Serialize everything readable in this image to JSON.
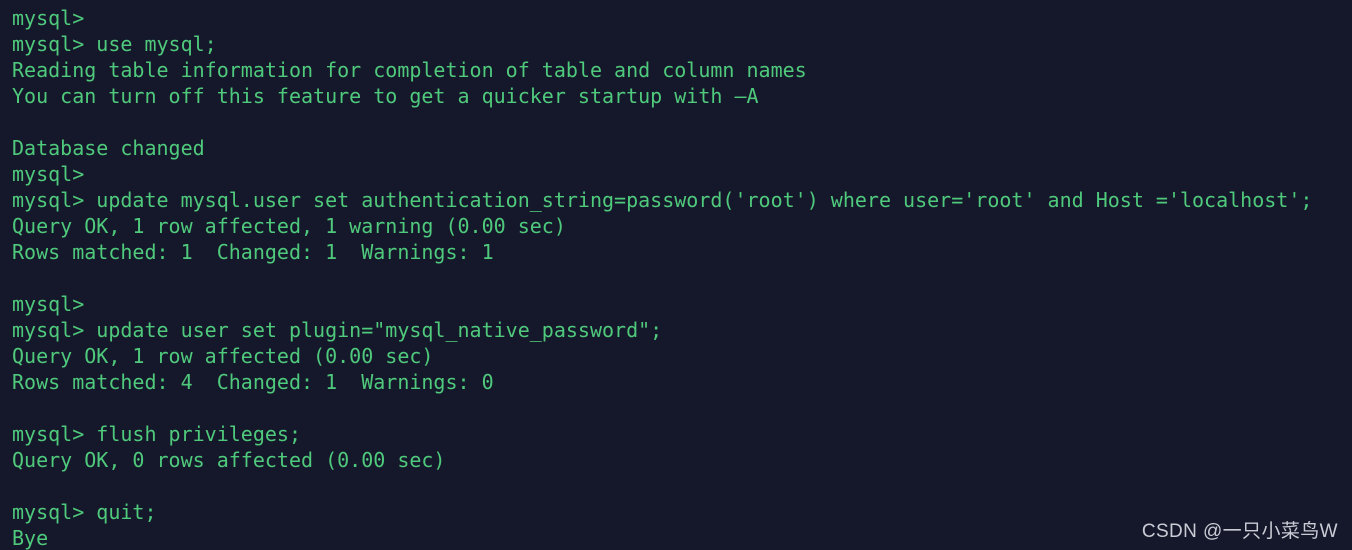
{
  "terminal": {
    "background_color": "#15182a",
    "text_color": "#4fc97c",
    "prompt": "mysql>",
    "lines": [
      "mysql>",
      "mysql> use mysql;",
      "Reading table information for completion of table and column names",
      "You can turn off this feature to get a quicker startup with –A",
      "",
      "Database changed",
      "mysql>",
      "mysql> update mysql.user set authentication_string=password('root') where user='root' and Host ='localhost';",
      "Query OK, 1 row affected, 1 warning (0.00 sec)",
      "Rows matched: 1  Changed: 1  Warnings: 1",
      "",
      "mysql>",
      "mysql> update user set plugin=\"mysql_native_password\";",
      "Query OK, 1 row affected (0.00 sec)",
      "Rows matched: 4  Changed: 1  Warnings: 0",
      "",
      "mysql> flush privileges;",
      "Query OK, 0 rows affected (0.00 sec)",
      "",
      "mysql> quit;",
      "Bye"
    ]
  },
  "watermark": {
    "text": "CSDN @一只小菜鸟W",
    "color": "#c9ccd5"
  }
}
